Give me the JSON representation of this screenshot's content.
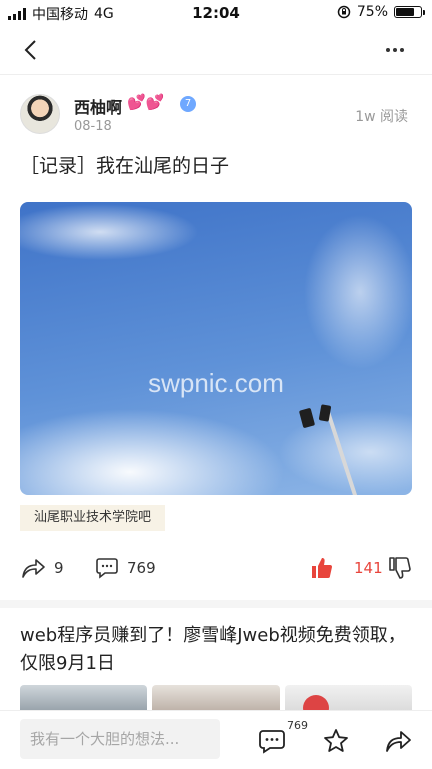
{
  "status_bar": {
    "carrier": "中国移动",
    "network": "4G",
    "time": "12:04",
    "battery": "75%",
    "battery_level": 0.75
  },
  "post": {
    "author_name": "西柚啊",
    "author_emoji": "💕💕",
    "badge_level": "7",
    "date": "08-18",
    "reads": "1w 阅读",
    "title": "［记录］我在汕尾的日子",
    "image_watermark": "swpnic.com",
    "tag": "汕尾职业技术学院吧",
    "share_count": "9",
    "comment_count": "769",
    "like_count": "141"
  },
  "recommendation": {
    "title": "web程序员赚到了！廖雪峰Jweb视频免费领取，仅限9月1日"
  },
  "bottom_bar": {
    "comment_placeholder": "我有一个大胆的想法...",
    "comment_badge": "769"
  },
  "colors": {
    "accent": "#e8453c",
    "tag_bg": "#f7f2e6",
    "muted": "#999999"
  },
  "icons": [
    "back-icon",
    "more-icon",
    "share-icon",
    "comment-icon",
    "thumb-up-icon",
    "thumb-down-icon",
    "star-icon",
    "forward-icon"
  ]
}
